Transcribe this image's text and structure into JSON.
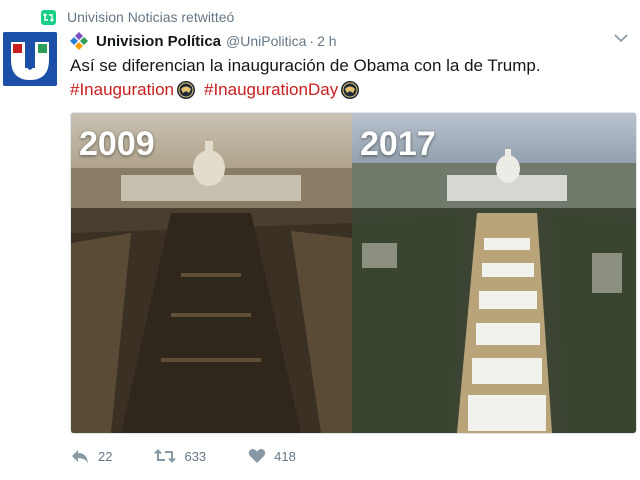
{
  "retweet_context": {
    "text": "Univision Noticias retwitteó",
    "icon": "retweet-icon"
  },
  "author": {
    "name": "Univision Política",
    "handle": "@UniPolitica",
    "separator": "·",
    "time": "2 h"
  },
  "tweet": {
    "text": "Así se diferencian la inauguración de Obama con la de Trump.",
    "hashtags": [
      "#Inauguration",
      "#InaugurationDay"
    ]
  },
  "media": {
    "left_label": "2009",
    "right_label": "2017"
  },
  "actions": {
    "reply_count": "22",
    "retweet_count": "633",
    "like_count": "418"
  },
  "colors": {
    "hashtag": "#c81e1e",
    "meta": "#657786",
    "retweet_green": "#19cf86",
    "avatar_blue": "#1b4fa8"
  }
}
